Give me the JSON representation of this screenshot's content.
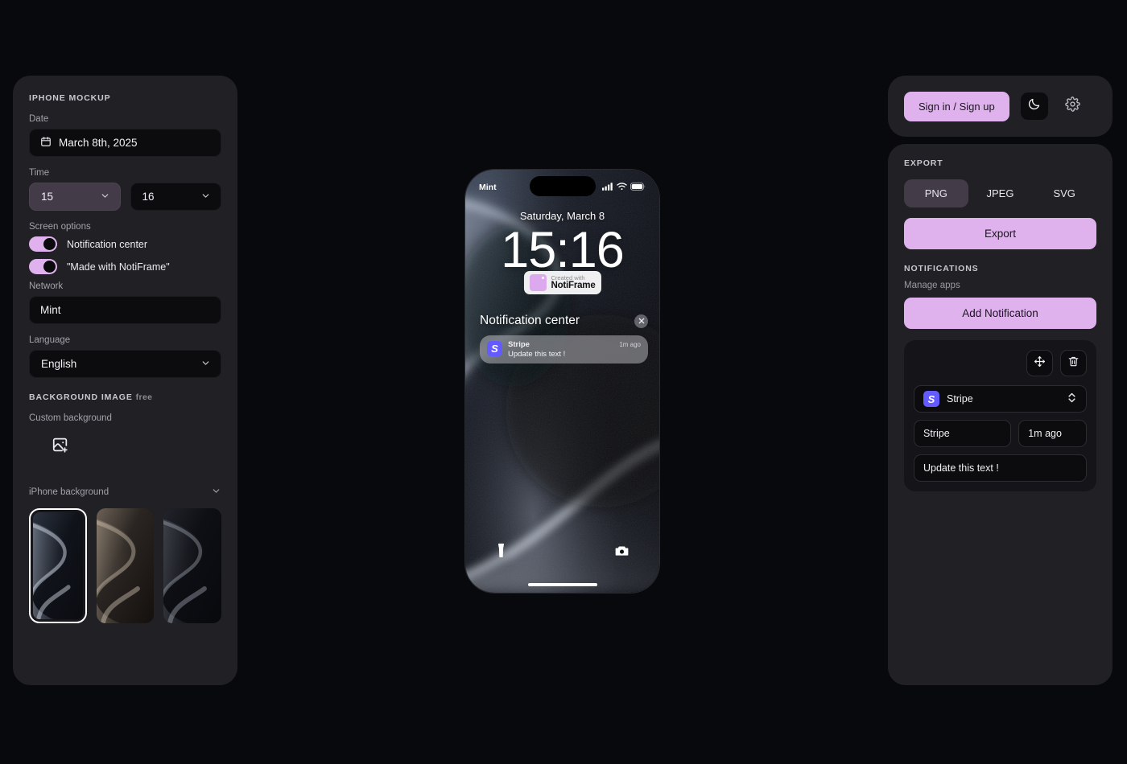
{
  "sidebar": {
    "section_title": "IPHONE MOCKUP",
    "date": {
      "label": "Date",
      "value": "March 8th, 2025",
      "icon": "calendar-icon"
    },
    "time": {
      "label": "Time",
      "hour": "15",
      "minute": "16"
    },
    "screen_options": {
      "label": "Screen options",
      "toggles": [
        {
          "label": "Notification center",
          "on": true
        },
        {
          "label": "\"Made with NotiFrame\"",
          "on": true
        }
      ]
    },
    "network": {
      "label": "Network",
      "value": "Mint"
    },
    "language": {
      "label": "Language",
      "value": "English"
    },
    "background": {
      "section_title": "BACKGROUND IMAGE",
      "section_badge": "free",
      "custom_label": "Custom background",
      "upload_icon": "image-plus-icon",
      "collapse_label": "iPhone background",
      "thumbnails": [
        {
          "name": "natural-titanium-wave",
          "selected": true
        },
        {
          "name": "desert-titanium-wave",
          "selected": false
        },
        {
          "name": "black-titanium-wave",
          "selected": false
        }
      ]
    }
  },
  "phone": {
    "status": {
      "carrier": "Mint",
      "signal_icon": "cellular-bars-icon",
      "wifi_icon": "wifi-icon",
      "battery_icon": "battery-full-icon"
    },
    "lock": {
      "date": "Saturday, March 8",
      "time": "15:16"
    },
    "badge": {
      "line1": "Created with",
      "line2": "NotiFrame"
    },
    "notification_center": {
      "title": "Notification center",
      "close_icon": "close-icon",
      "items": [
        {
          "app": "Stripe",
          "time": "1m ago",
          "text": "Update this text !",
          "icon": "stripe-icon",
          "glyph": "S"
        }
      ]
    },
    "shortcuts": {
      "torch_icon": "flashlight-icon",
      "camera_icon": "camera-icon"
    }
  },
  "account": {
    "sign_in_label": "Sign in / Sign up",
    "theme_icon": "moon-icon",
    "settings_icon": "gear-icon"
  },
  "export": {
    "section_title": "EXPORT",
    "formats": [
      {
        "label": "PNG",
        "active": true
      },
      {
        "label": "JPEG",
        "active": false
      },
      {
        "label": "SVG",
        "active": false
      }
    ],
    "export_button": "Export"
  },
  "notifications": {
    "section_title": "NOTIFICATIONS",
    "manage_label": "Manage apps",
    "add_button": "Add Notification",
    "editor": {
      "move_icon": "move-icon",
      "delete_icon": "trash-icon",
      "app": {
        "name": "Stripe",
        "glyph": "S",
        "chevron_icon": "chevron-updown-icon"
      },
      "title_value": "Stripe",
      "time_value": "1m ago",
      "text_value": "Update this text !"
    }
  },
  "colors": {
    "page_bg": "#08090c",
    "panel_bg": "#212125",
    "input_bg": "#0c0c0f",
    "accent": "#dfb2ee",
    "accent_muted": "#443b48",
    "stripe": "#635bff",
    "text": "#f2f1f5",
    "text_muted": "#a3a1aa"
  }
}
